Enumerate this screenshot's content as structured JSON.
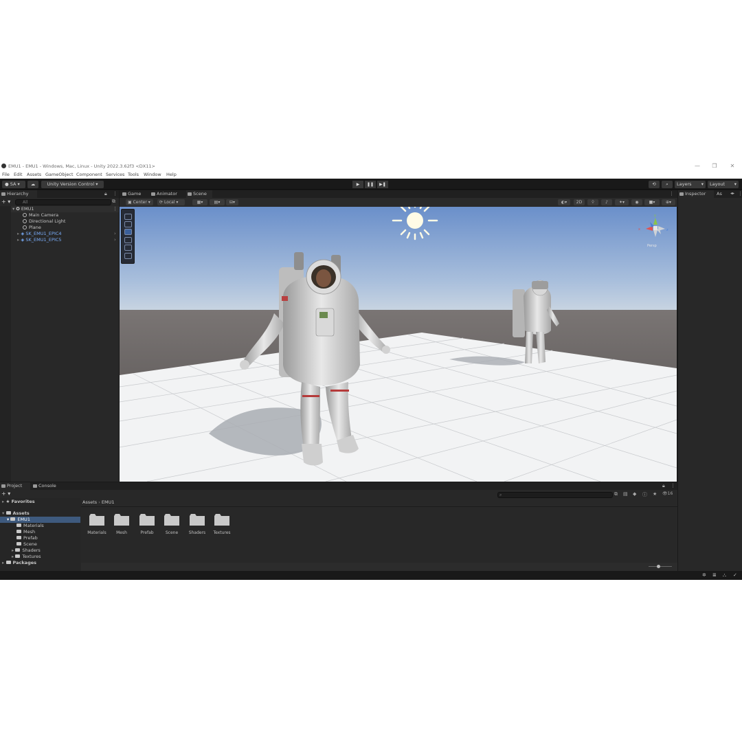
{
  "window": {
    "title": "EMU1 - EMU1 - Windows, Mac, Linux - Unity 2022.3.62f3 <DX11>",
    "minimize": "—",
    "maximize": "❐",
    "close": "✕"
  },
  "menu": [
    "File",
    "Edit",
    "Assets",
    "GameObject",
    "Component",
    "Services",
    "Tools",
    "Window",
    "Help"
  ],
  "toolbar": {
    "account": "SA",
    "version_control": "Unity Version Control",
    "play": "▶",
    "pause": "❚❚",
    "step": "▶❚",
    "layers": "Layers",
    "layout": "Layout"
  },
  "hierarchy": {
    "tab": "Hierarchy",
    "search_placeholder": "All",
    "root": "EMU1",
    "items": [
      "Main Camera",
      "Directional Light",
      "Plane",
      "SK_EMU1_EPIC4",
      "SK_EMU1_EPIC5"
    ]
  },
  "scene_tabs": [
    "Game",
    "Animator",
    "Scene"
  ],
  "scene_toolbar": {
    "pivot": "Center",
    "space": "Local",
    "mode_2d": "2D"
  },
  "gizmo": {
    "y": "y",
    "x": "x",
    "z": "z",
    "persp": "Persp"
  },
  "inspector": {
    "tab": "Inspector",
    "tab2": "As"
  },
  "project": {
    "tabs": [
      "Project",
      "Console"
    ],
    "favorites": "Favorites",
    "assets": "Assets",
    "emu1": "EMU1",
    "tree": [
      "Materials",
      "Mesh",
      "Prefab",
      "Scene",
      "Shaders",
      "Textures"
    ],
    "packages": "Packages",
    "breadcrumb": [
      "Assets",
      "EMU1"
    ],
    "breadcrumb_sep": "›",
    "folders": [
      "Materials",
      "Mesh",
      "Prefab",
      "Scene",
      "Shaders",
      "Textures"
    ],
    "hidden_count": "16"
  },
  "colors": {
    "accent_blue": "#7aaefc",
    "sky_top": "#6e91c9",
    "sky_horizon": "#c5d3e3",
    "ground": "#5d5857"
  }
}
